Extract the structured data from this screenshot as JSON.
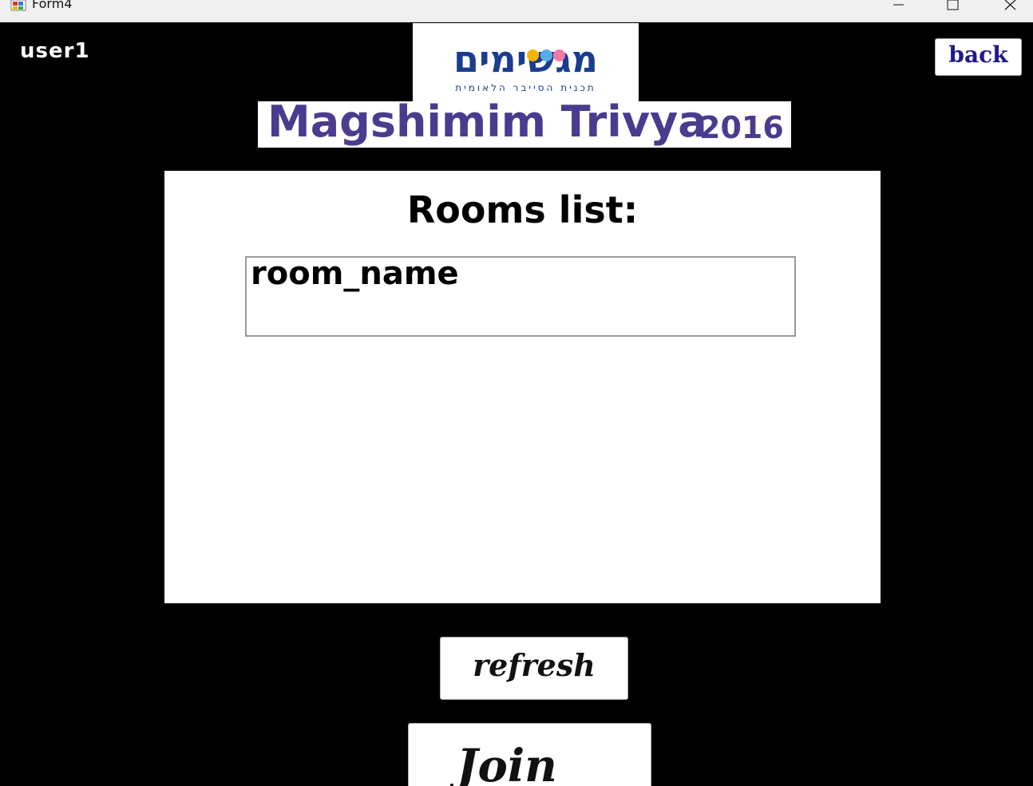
{
  "window": {
    "title": "Form4",
    "controls": [
      "minimize",
      "maximize",
      "close"
    ]
  },
  "header": {
    "username": "user1",
    "logo_hebrew": "מגשימים",
    "logo_subtitle": "תכנית הסייבר הלאומית",
    "banner_title": "Magshimim Trivya",
    "banner_year": "2016",
    "back_label": "back"
  },
  "rooms": {
    "title": "Rooms list:",
    "items": [
      "room_name"
    ]
  },
  "actions": {
    "refresh_label": "refresh",
    "join_label": "Join"
  },
  "colors": {
    "background": "#000000",
    "banner_text": "#4b3b8f",
    "logo_blue": "#1b3d8f",
    "back_text": "#1d1a8a"
  },
  "icons": [
    "app-icon",
    "minimize-icon",
    "maximize-icon",
    "close-icon"
  ]
}
